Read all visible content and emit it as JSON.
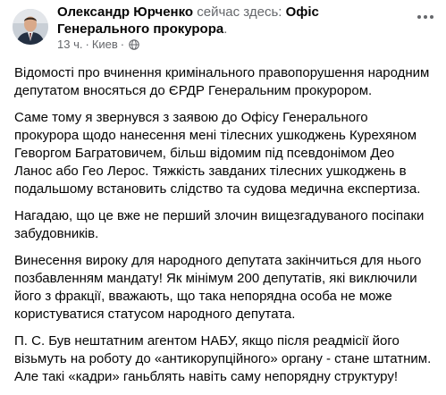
{
  "post": {
    "author": "Олександр Юрченко",
    "action": "сейчас здесь:",
    "group": "Офіс Генерального прокурора",
    "group_suffix": ".",
    "time": "13 ч.",
    "separator": "·",
    "location": "Киев",
    "privacy_icon": "globe-icon",
    "more_icon": "more-options-icon",
    "paragraphs": [
      "Відомості про вчинення кримінального правопорушення народним депутатом вносяться до ЄРДР Генеральним прокурором.",
      "Саме тому я звернувся з заявою до Офісу Генерального прокурора щодо нанесення мені тілесних ушкоджень Курехяном Геворгом Багратовичем, більш відомим під псевдонімом Део Ланос або Гео Лерос. Тяжкість завданих тілесних ушкоджень в подальшому встановить слідство та судова медична експертиза.",
      "Нагадаю, що це вже не перший злочин вищезгадуваного посіпаки забудовників.",
      "Винесення вироку для народного депутата закінчиться для нього позбавленням мандату! Як мінімум 200 депутатів, які виключили його з фракції, вважають, що така непорядна особа не може користуватися статусом народного депутата.",
      "П. С. Був нештатним агентом НАБУ, якщо після реадмісії його візьмуть на роботу до «антикорупційного» органу - стане штатним. Але такі «кадри» ганьблять навіть саму непорядну структуру!"
    ]
  },
  "colors": {
    "text": "#050505",
    "secondary": "#65676b",
    "background": "#ffffff"
  }
}
